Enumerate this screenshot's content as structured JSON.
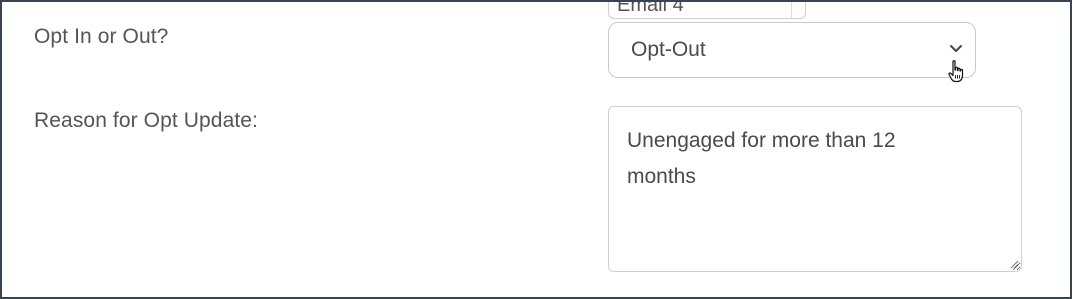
{
  "previous_field": {
    "value": "Email 4"
  },
  "opt_field": {
    "label": "Opt In or Out?",
    "selected": "Opt-Out",
    "chevron_icon": "chevron-down-icon",
    "cursor_icon": "hand-pointer-icon"
  },
  "reason_field": {
    "label": "Reason for Opt Update:",
    "value": "Unengaged for more than 12 months"
  },
  "colors": {
    "border_frame": "#3a4450",
    "label_text": "#555555",
    "input_border": "#c8c8c8"
  }
}
